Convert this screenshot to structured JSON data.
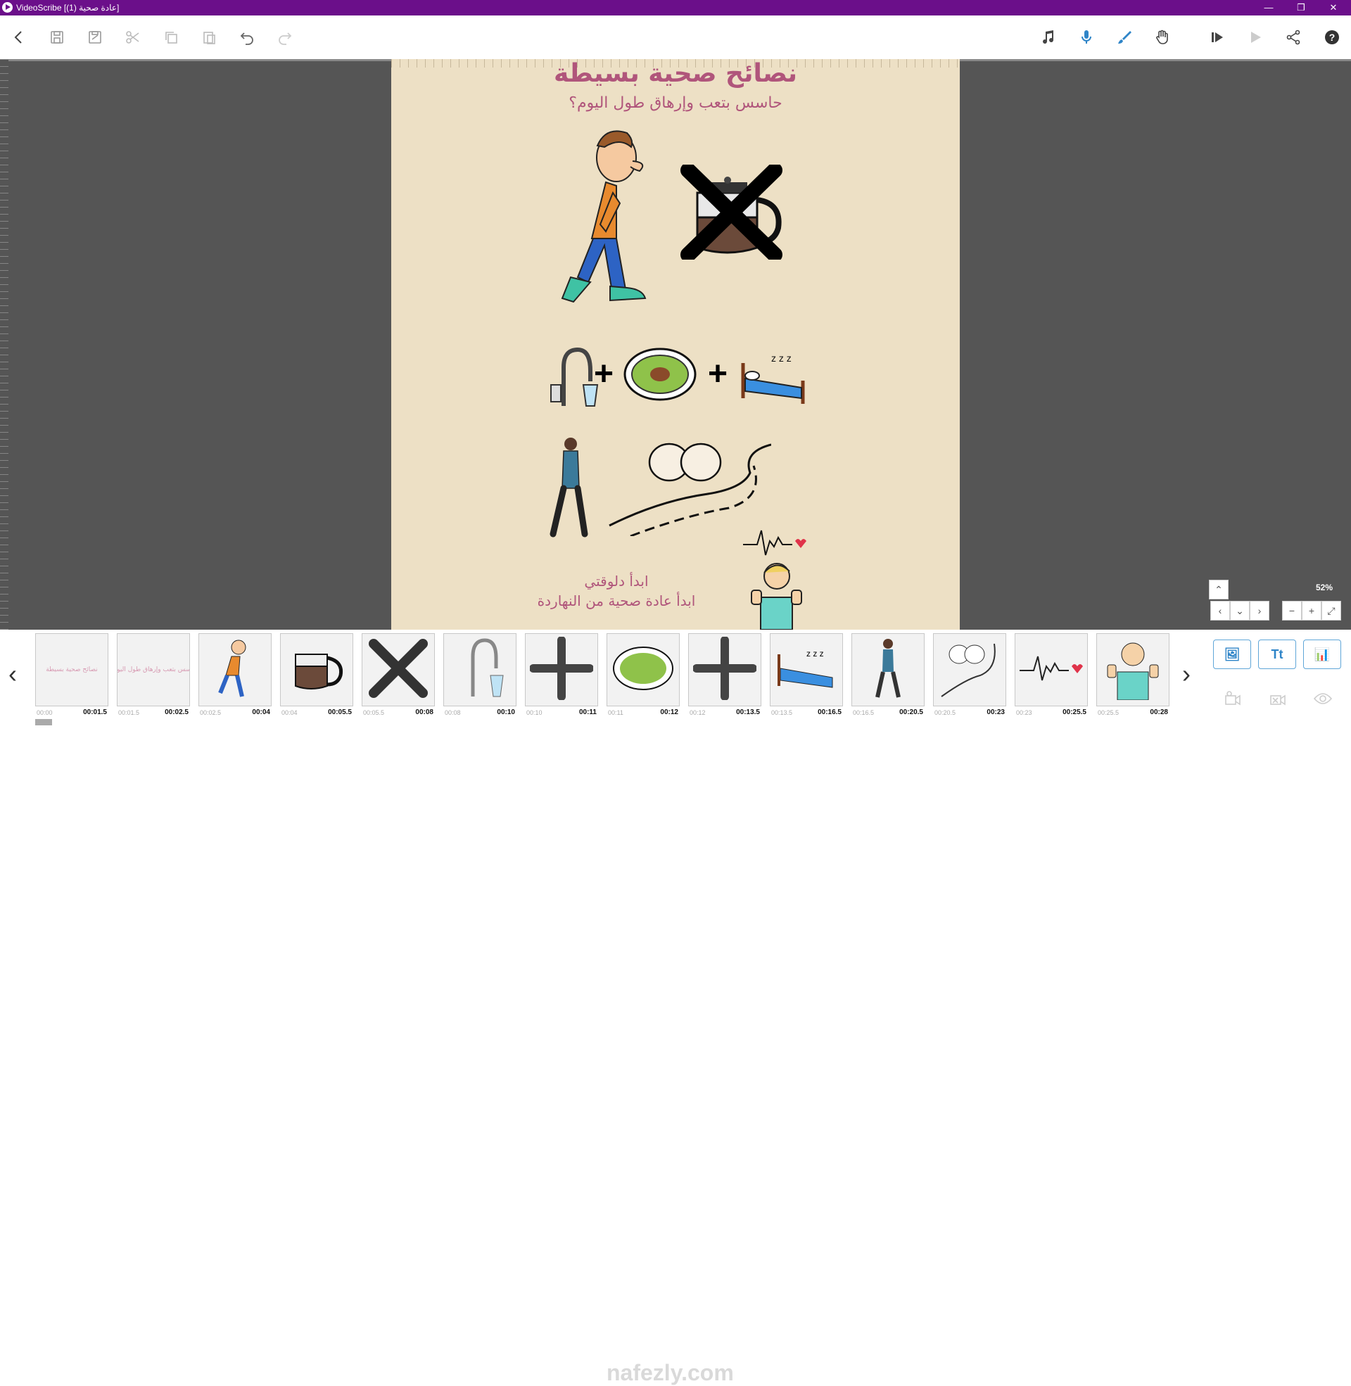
{
  "window": {
    "title": "VideoScribe [(1) عادة صحية]",
    "controls": {
      "minimize": "—",
      "maximize": "❐",
      "close": "✕"
    }
  },
  "toolbar": {
    "left": [
      {
        "name": "back-icon"
      },
      {
        "name": "save-icon"
      },
      {
        "name": "save-as-icon"
      },
      {
        "name": "cut-icon"
      },
      {
        "name": "copy-icon"
      },
      {
        "name": "paste-icon"
      },
      {
        "name": "undo-icon"
      },
      {
        "name": "redo-icon"
      }
    ],
    "right": [
      {
        "name": "music-icon"
      },
      {
        "name": "microphone-icon"
      },
      {
        "name": "brush-icon"
      },
      {
        "name": "hand-icon"
      },
      {
        "name": "play-from-here-icon"
      },
      {
        "name": "play-icon"
      },
      {
        "name": "share-icon"
      },
      {
        "name": "help-icon"
      }
    ]
  },
  "canvas": {
    "title": "نصائح صحية بسيطة",
    "subtitle": "حاسس بتعب وإرهاق طول اليوم؟",
    "closing_line1": "ابدأ دلوقتي",
    "closing_line2": "ابدأ عادة صحية من النهاردة",
    "background_color": "#ede0c5",
    "text_color": "#b0557b"
  },
  "zoom": {
    "level": "52%"
  },
  "timeline": {
    "thumbs": [
      {
        "kind": "text",
        "text": "نصائح صحية بسيطة",
        "start": "00:00",
        "end": "00:01.5"
      },
      {
        "kind": "text",
        "text": "حاسس بتعب وإرهاق طول اليوم؟",
        "start": "00:01.5",
        "end": "00:02.5"
      },
      {
        "kind": "man",
        "start": "00:02.5",
        "end": "00:04"
      },
      {
        "kind": "teapot",
        "start": "00:04",
        "end": "00:05.5"
      },
      {
        "kind": "cross",
        "start": "00:05.5",
        "end": "00:08"
      },
      {
        "kind": "faucet",
        "start": "00:08",
        "end": "00:10"
      },
      {
        "kind": "plus",
        "start": "00:10",
        "end": "00:11"
      },
      {
        "kind": "salad",
        "start": "00:11",
        "end": "00:12"
      },
      {
        "kind": "plus",
        "start": "00:12",
        "end": "00:13.5"
      },
      {
        "kind": "bed",
        "start": "00:13.5",
        "end": "00:16.5"
      },
      {
        "kind": "walker",
        "start": "00:16.5",
        "end": "00:20.5"
      },
      {
        "kind": "road",
        "start": "00:20.5",
        "end": "00:23"
      },
      {
        "kind": "heartbeat",
        "start": "00:23",
        "end": "00:25.5"
      },
      {
        "kind": "thumbsup",
        "start": "00:25.5",
        "end": "00:28"
      }
    ],
    "add_buttons": [
      "🖼",
      "Tt",
      "📊"
    ]
  },
  "watermark": "nafezly.com"
}
